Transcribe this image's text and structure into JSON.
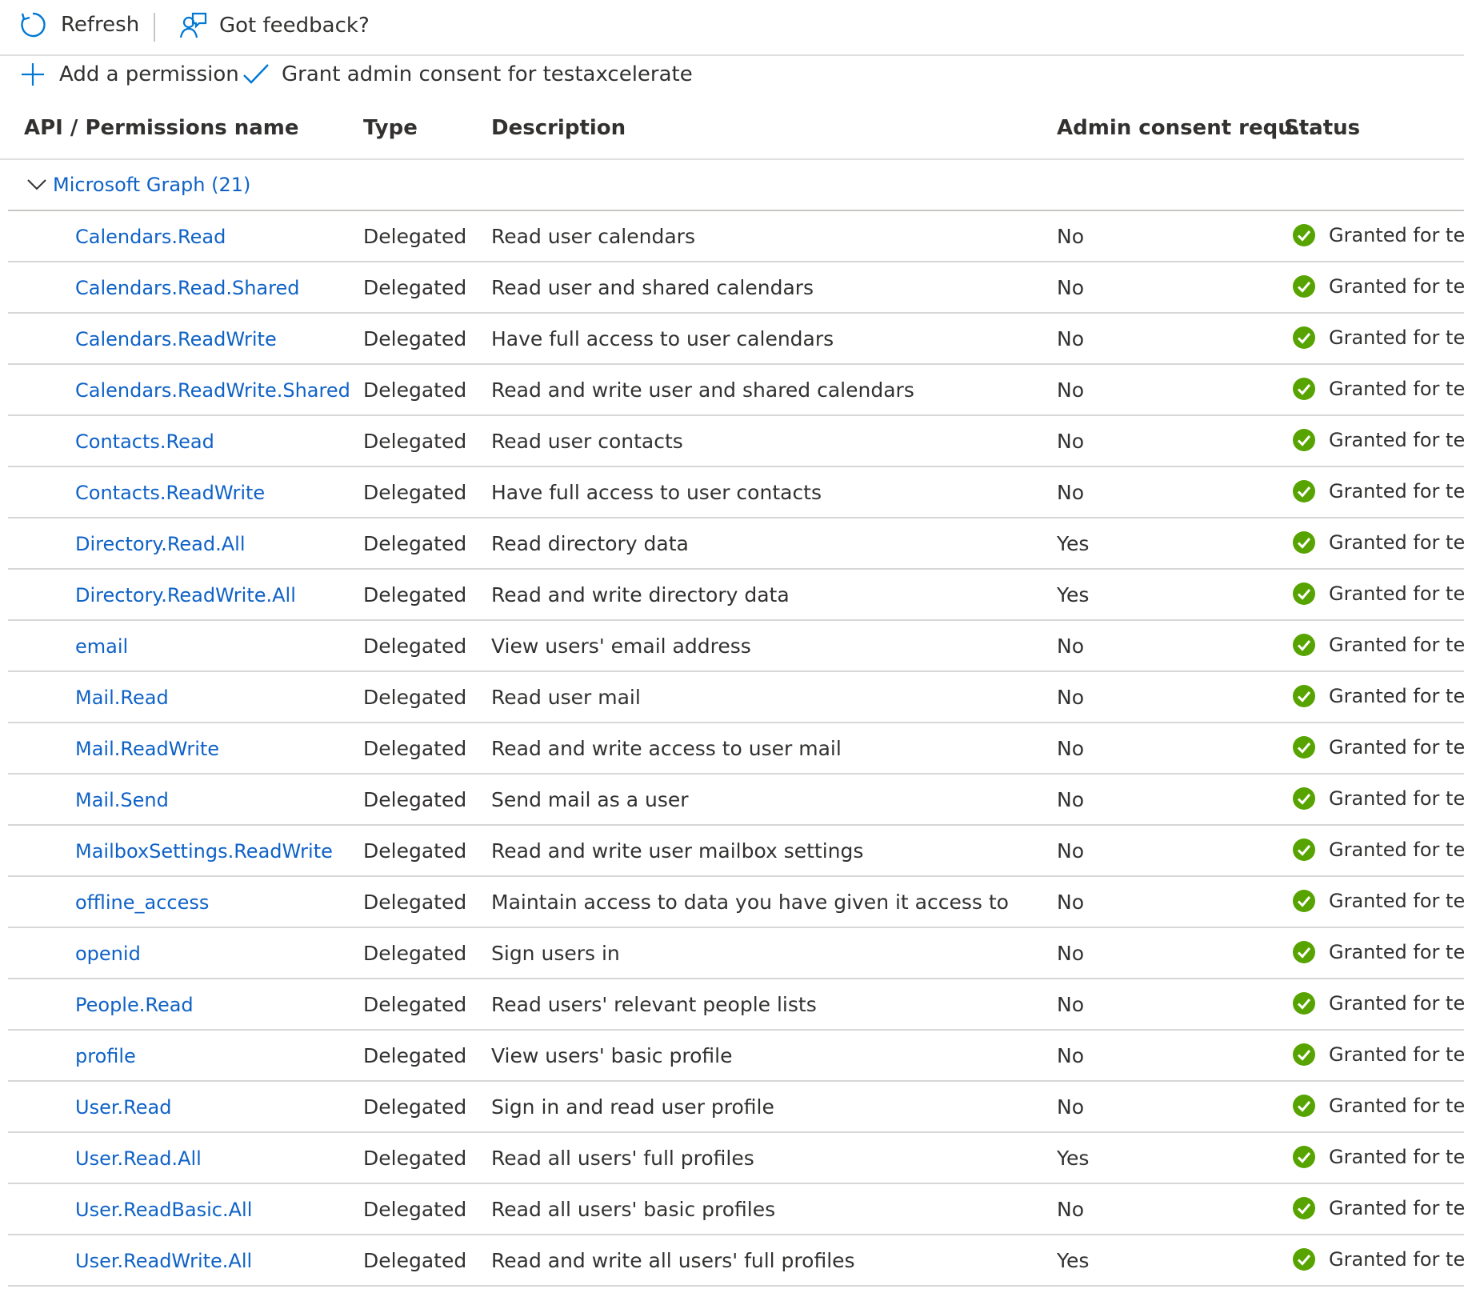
{
  "toolbar": {
    "refresh_label": "Refresh",
    "feedback_label": "Got feedback?",
    "add_permission_label": "Add a permission",
    "grant_consent_label": "Grant admin consent for testaxcelerate"
  },
  "table": {
    "columns": [
      "API / Permissions name",
      "Type",
      "Description",
      "Admin consent requ...",
      "Status"
    ],
    "group_label": "Microsoft Graph (21)",
    "rows": [
      {
        "name": "Calendars.Read",
        "type": "Delegated",
        "description": "Read user calendars",
        "admin": "No",
        "status": "Granted for testa"
      },
      {
        "name": "Calendars.Read.Shared",
        "type": "Delegated",
        "description": "Read user and shared calendars",
        "admin": "No",
        "status": "Granted for testa"
      },
      {
        "name": "Calendars.ReadWrite",
        "type": "Delegated",
        "description": "Have full access to user calendars",
        "admin": "No",
        "status": "Granted for testa"
      },
      {
        "name": "Calendars.ReadWrite.Shared",
        "type": "Delegated",
        "description": "Read and write user and shared calendars",
        "admin": "No",
        "status": "Granted for testa"
      },
      {
        "name": "Contacts.Read",
        "type": "Delegated",
        "description": "Read user contacts",
        "admin": "No",
        "status": "Granted for testa"
      },
      {
        "name": "Contacts.ReadWrite",
        "type": "Delegated",
        "description": "Have full access to user contacts",
        "admin": "No",
        "status": "Granted for testa"
      },
      {
        "name": "Directory.Read.All",
        "type": "Delegated",
        "description": "Read directory data",
        "admin": "Yes",
        "status": "Granted for testa"
      },
      {
        "name": "Directory.ReadWrite.All",
        "type": "Delegated",
        "description": "Read and write directory data",
        "admin": "Yes",
        "status": "Granted for testa"
      },
      {
        "name": "email",
        "type": "Delegated",
        "description": "View users' email address",
        "admin": "No",
        "status": "Granted for testa"
      },
      {
        "name": "Mail.Read",
        "type": "Delegated",
        "description": "Read user mail",
        "admin": "No",
        "status": "Granted for testa"
      },
      {
        "name": "Mail.ReadWrite",
        "type": "Delegated",
        "description": "Read and write access to user mail",
        "admin": "No",
        "status": "Granted for testa"
      },
      {
        "name": "Mail.Send",
        "type": "Delegated",
        "description": "Send mail as a user",
        "admin": "No",
        "status": "Granted for testa"
      },
      {
        "name": "MailboxSettings.ReadWrite",
        "type": "Delegated",
        "description": "Read and write user mailbox settings",
        "admin": "No",
        "status": "Granted for testa"
      },
      {
        "name": "offline_access",
        "type": "Delegated",
        "description": "Maintain access to data you have given it access to",
        "admin": "No",
        "status": "Granted for testa"
      },
      {
        "name": "openid",
        "type": "Delegated",
        "description": "Sign users in",
        "admin": "No",
        "status": "Granted for testa"
      },
      {
        "name": "People.Read",
        "type": "Delegated",
        "description": "Read users' relevant people lists",
        "admin": "No",
        "status": "Granted for testa"
      },
      {
        "name": "profile",
        "type": "Delegated",
        "description": "View users' basic profile",
        "admin": "No",
        "status": "Granted for testa"
      },
      {
        "name": "User.Read",
        "type": "Delegated",
        "description": "Sign in and read user profile",
        "admin": "No",
        "status": "Granted for testa"
      },
      {
        "name": "User.Read.All",
        "type": "Delegated",
        "description": "Read all users' full profiles",
        "admin": "Yes",
        "status": "Granted for testa"
      },
      {
        "name": "User.ReadBasic.All",
        "type": "Delegated",
        "description": "Read all users' basic profiles",
        "admin": "No",
        "status": "Granted for testa"
      },
      {
        "name": "User.ReadWrite.All",
        "type": "Delegated",
        "description": "Read and write all users' full profiles",
        "admin": "Yes",
        "status": "Granted for testa"
      }
    ]
  },
  "colors": {
    "link": "#0f62c7",
    "accent_icon": "#0078d4",
    "granted": "#57a300",
    "text": "#323130"
  },
  "icons": [
    "refresh-icon",
    "feedback-icon",
    "plus-icon",
    "checkmark-icon",
    "chevron-down-icon",
    "granted-check-icon"
  ]
}
